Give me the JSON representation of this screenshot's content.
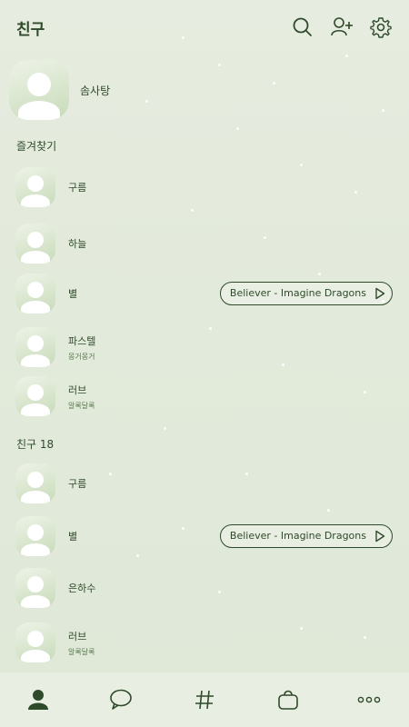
{
  "header": {
    "title": "친구",
    "icons": [
      "search-icon",
      "add-friend-icon",
      "settings-icon"
    ]
  },
  "profile": {
    "name": "솜사탕"
  },
  "favorites": {
    "label": "즐겨찾기",
    "items": [
      {
        "name": "구름",
        "status": ""
      },
      {
        "name": "하늘",
        "status": ""
      },
      {
        "name": "별",
        "status": "",
        "music": "Believer - Imagine Dragons"
      },
      {
        "name": "파스텔",
        "status": "몽거몽거"
      },
      {
        "name": "러브",
        "status": "알록달록"
      }
    ]
  },
  "friends": {
    "label": "친구 18",
    "items": [
      {
        "name": "구름",
        "status": ""
      },
      {
        "name": "별",
        "status": "",
        "music": "Believer - Imagine Dragons"
      },
      {
        "name": "은하수",
        "status": ""
      },
      {
        "name": "러브",
        "status": "알록달록"
      }
    ]
  },
  "tabbar": {
    "tabs": [
      "friends-tab",
      "chat-tab",
      "hashtag-tab",
      "shopping-tab",
      "more-tab"
    ],
    "active": "friends-tab"
  },
  "colors": {
    "accent": "#2f4a2a",
    "background": "#e4ebdd"
  }
}
